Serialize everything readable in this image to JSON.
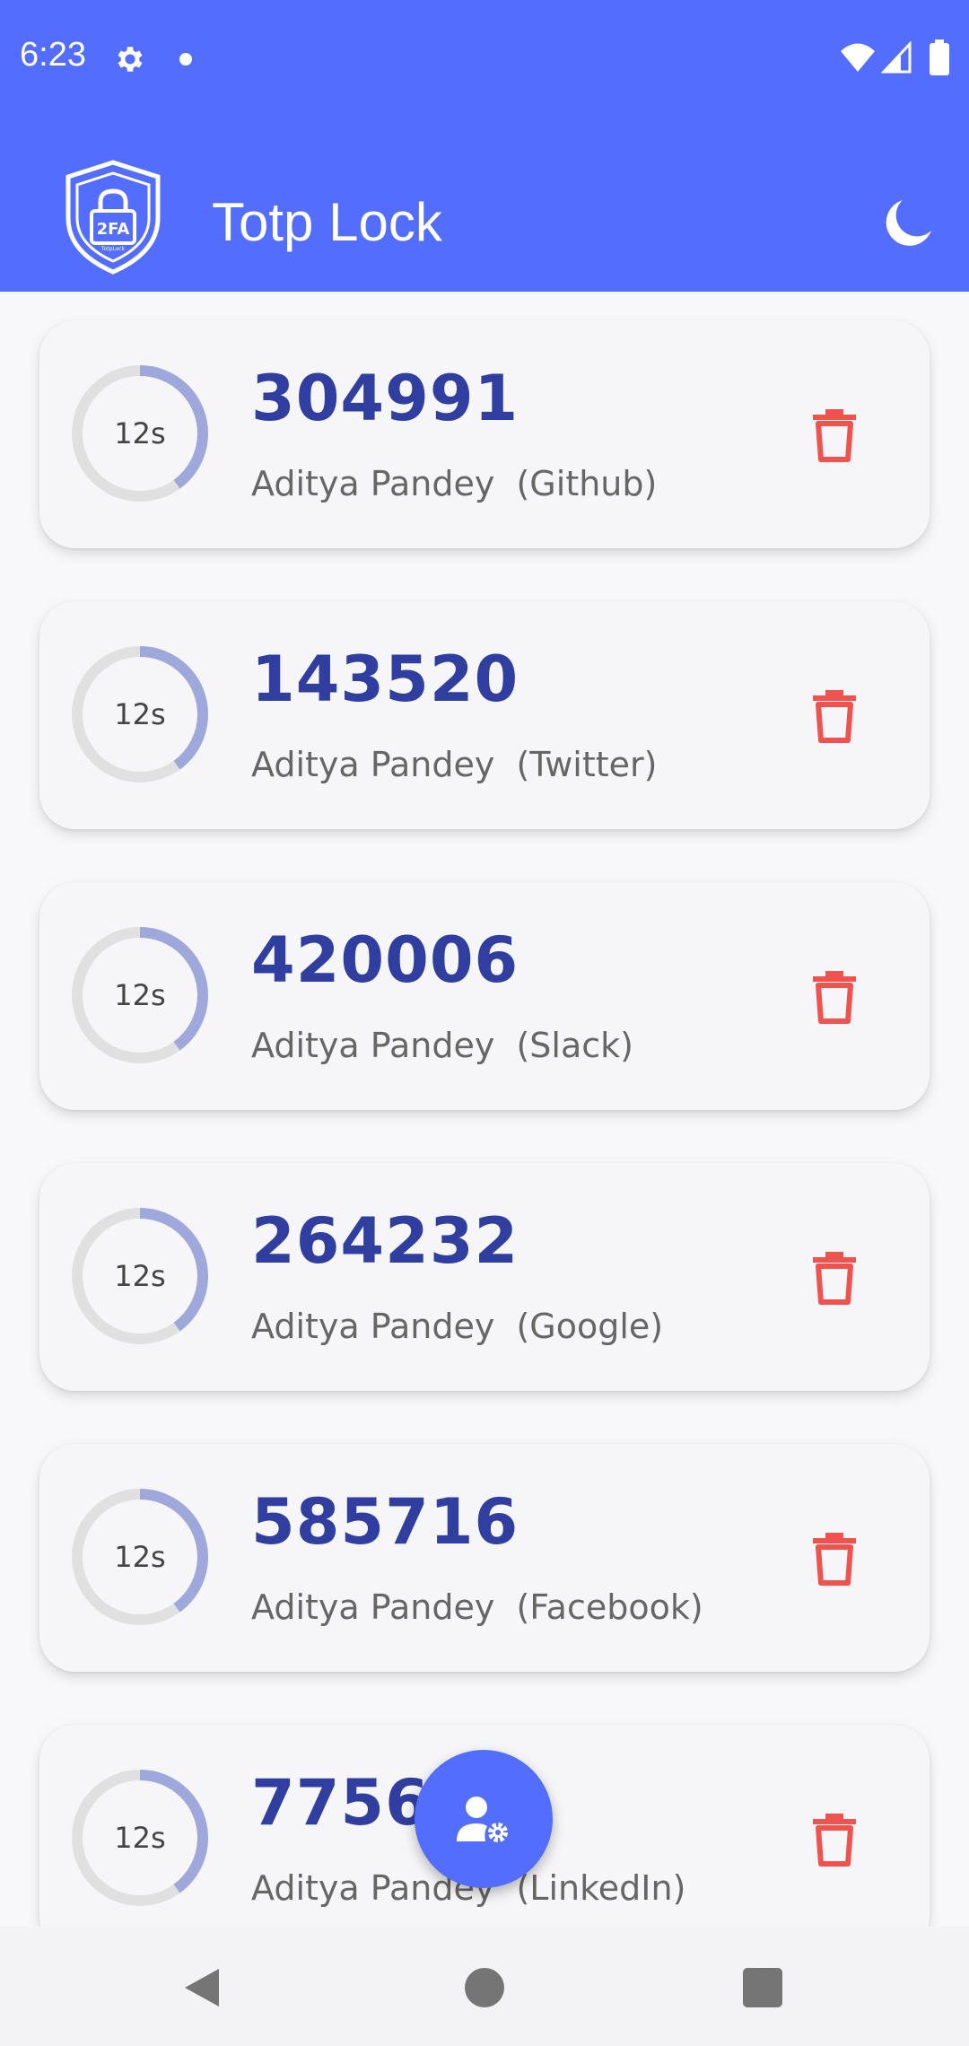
{
  "status_bar": {
    "time": "6:23"
  },
  "app_bar": {
    "logo_text": "2FA",
    "logo_subtext": "TotpLock",
    "title": "Totp Lock"
  },
  "accounts": [
    {
      "code": "304991",
      "label": "Aditya Pandey  (Github)",
      "timer": "12s",
      "progress": 0.4
    },
    {
      "code": "143520",
      "label": "Aditya Pandey  (Twitter)",
      "timer": "12s",
      "progress": 0.4
    },
    {
      "code": "420006",
      "label": "Aditya Pandey  (Slack)",
      "timer": "12s",
      "progress": 0.4
    },
    {
      "code": "264232",
      "label": "Aditya Pandey  (Google)",
      "timer": "12s",
      "progress": 0.4
    },
    {
      "code": "585716",
      "label": "Aditya Pandey  (Facebook)",
      "timer": "12s",
      "progress": 0.4
    },
    {
      "code": "775644",
      "label": "Aditya Pandey  (LinkedIn)",
      "timer": "12s",
      "progress": 0.4
    }
  ],
  "colors": {
    "primary": "#536dfe",
    "code_text": "#303f9f",
    "ring_track": "#e0e0e0",
    "ring_progress": "#9fa8da",
    "delete": "#ef5350"
  },
  "icons": {
    "settings": "gear-icon",
    "theme": "moon-icon",
    "delete": "trash-icon",
    "fab": "user-settings-icon"
  }
}
